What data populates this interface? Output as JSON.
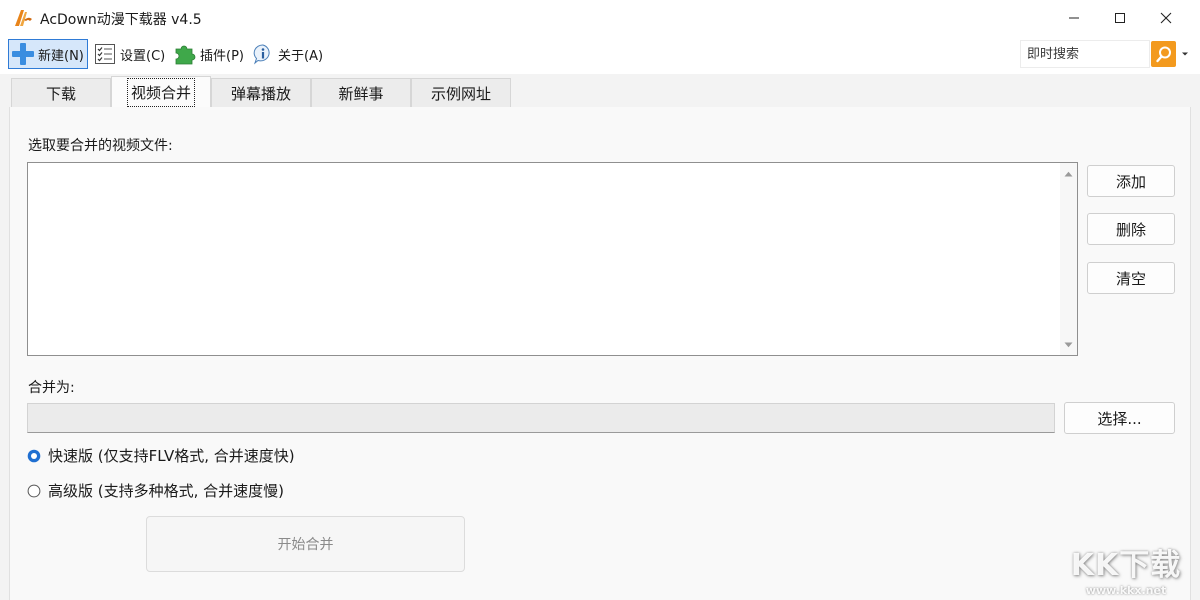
{
  "window": {
    "title": "AcDown动漫下载器 v4.5"
  },
  "menu": {
    "new": "新建(N)",
    "settings": "设置(C)",
    "plugins": "插件(P)",
    "about": "关于(A)"
  },
  "search": {
    "placeholder": "即时搜索"
  },
  "tabs": [
    {
      "label": "下载",
      "active": false
    },
    {
      "label": "视频合并",
      "active": true
    },
    {
      "label": "弹幕播放",
      "active": false
    },
    {
      "label": "新鲜事",
      "active": false
    },
    {
      "label": "示例网址",
      "active": false
    }
  ],
  "merge_panel": {
    "select_label": "选取要合并的视频文件:",
    "add_button": "添加",
    "delete_button": "删除",
    "clear_button": "清空",
    "output_label": "合并为:",
    "output_value": "",
    "choose_button": "选择...",
    "option_fast": "快速版 (仅支持FLV格式, 合并速度快)",
    "option_advanced": "高级版 (支持多种格式, 合并速度慢)",
    "selected_option": "fast",
    "start_button": "开始合并"
  },
  "watermark": {
    "main": "KK下载",
    "sub": "www.kkx.net"
  },
  "colors": {
    "accent_blue": "#2f7bd6",
    "search_orange": "#f39a1e",
    "logo_orange": "#e8841a"
  }
}
